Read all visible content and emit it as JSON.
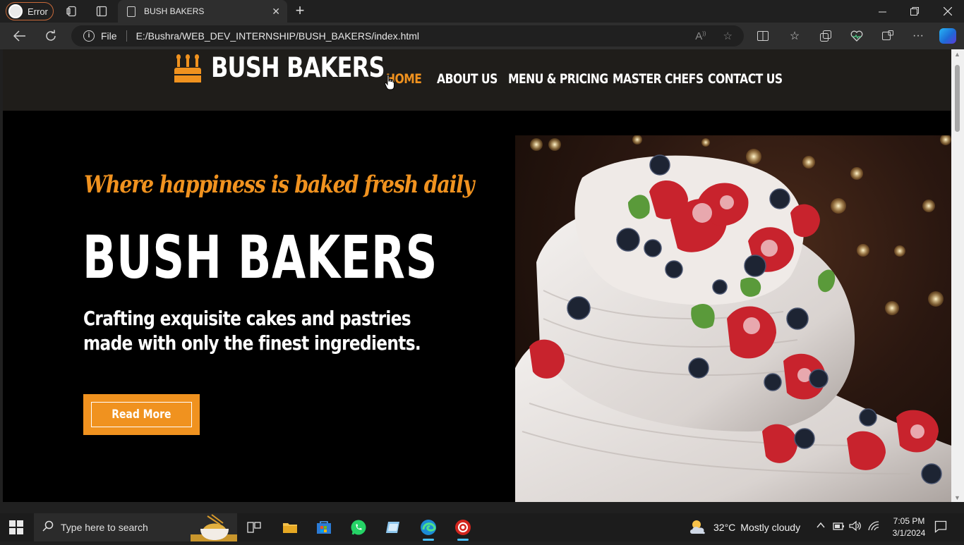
{
  "browser": {
    "profile_label": "Error",
    "tab": {
      "title": "BUSH BAKERS"
    },
    "address": {
      "scheme_label": "File",
      "url": "E:/Bushra/WEB_DEV_INTERNSHIP/BUSH_BAKERS/index.html"
    }
  },
  "site": {
    "logo_text": "BUSH BAKERS",
    "nav": [
      {
        "label": "HOME",
        "active": true
      },
      {
        "label": "ABOUT US",
        "active": false
      },
      {
        "label": "MENU & PRICING",
        "active": false
      },
      {
        "label": "MASTER CHEFS",
        "active": false
      },
      {
        "label": "CONTACT US",
        "active": false
      }
    ],
    "hero": {
      "tagline": "Where happiness is baked fresh daily",
      "title": "BUSH BAKERS",
      "description": "Crafting exquisite cakes and pastries made with only the finest ingredients.",
      "button_label": "Read More"
    },
    "colors": {
      "accent": "#f0921f",
      "header_bg": "#1f1d1a",
      "hero_bg": "#000000"
    }
  },
  "taskbar": {
    "search_placeholder": "Type here to search",
    "weather": {
      "temp": "32°C",
      "condition": "Mostly cloudy"
    },
    "clock": {
      "time": "7:05 PM",
      "date": "3/1/2024"
    }
  }
}
